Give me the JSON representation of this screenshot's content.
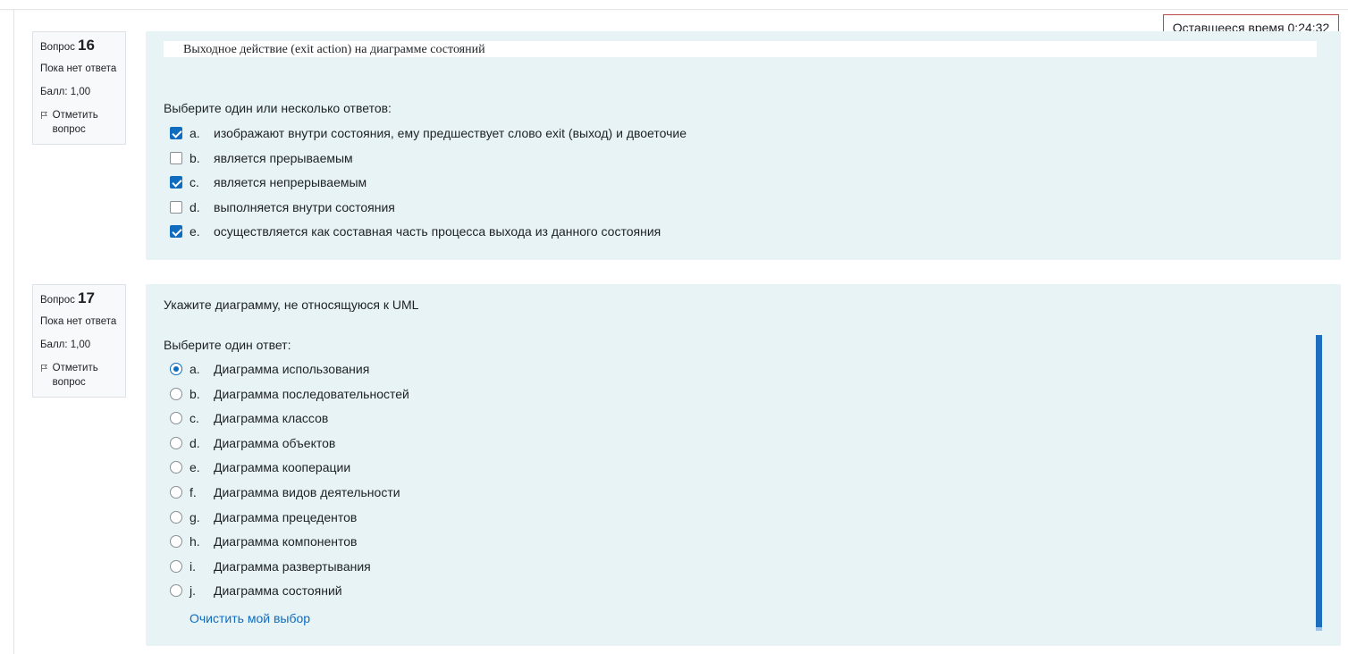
{
  "timer": {
    "label": "Оставшееся время 0:24:32"
  },
  "questions": [
    {
      "info": {
        "label": "Вопрос",
        "number": "16",
        "status": "Пока нет ответа",
        "score": "Балл: 1,00",
        "flag": "Отметить вопрос"
      },
      "text": "Выходное действие (exit action) на диаграмме состояний",
      "prompt": "Выберите один или несколько ответов:",
      "answers": [
        {
          "letter": "a.",
          "text": "изображают внутри состояния, ему предшествует слово exit (выход) и двоеточие",
          "checked": true
        },
        {
          "letter": "b.",
          "text": "является прерываемым",
          "checked": false
        },
        {
          "letter": "c.",
          "text": "является непрерываемым",
          "checked": true
        },
        {
          "letter": "d.",
          "text": "выполняется внутри состояния",
          "checked": false
        },
        {
          "letter": "e.",
          "text": "осуществляется как составная часть процесса выхода из данного состояния",
          "checked": true
        }
      ]
    },
    {
      "info": {
        "label": "Вопрос",
        "number": "17",
        "status": "Пока нет ответа",
        "score": "Балл: 1,00",
        "flag": "Отметить вопрос"
      },
      "text": "Укажите диаграмму, не относящуюся к UML",
      "prompt": "Выберите один ответ:",
      "answers": [
        {
          "letter": "a.",
          "text": "Диаграмма использования",
          "checked": true
        },
        {
          "letter": "b.",
          "text": "Диаграмма последовательностей",
          "checked": false
        },
        {
          "letter": "c.",
          "text": "Диаграмма классов",
          "checked": false
        },
        {
          "letter": "d.",
          "text": "Диаграмма объектов",
          "checked": false
        },
        {
          "letter": "e.",
          "text": "Диаграмма кооперации",
          "checked": false
        },
        {
          "letter": "f.",
          "text": "Диаграмма видов деятельности",
          "checked": false
        },
        {
          "letter": "g.",
          "text": "Диаграмма прецедентов",
          "checked": false
        },
        {
          "letter": "h.",
          "text": "Диаграмма компонентов",
          "checked": false
        },
        {
          "letter": "i.",
          "text": "Диаграмма развертывания",
          "checked": false
        },
        {
          "letter": "j.",
          "text": "Диаграмма состояний",
          "checked": false
        }
      ],
      "clear_label": "Очистить мой выбор"
    }
  ],
  "colors": {
    "accent": "#0f6cbf",
    "content_bg": "#e7f3f5",
    "timer_border": "#b94a48"
  },
  "icons": {
    "flag": "flag-icon"
  }
}
